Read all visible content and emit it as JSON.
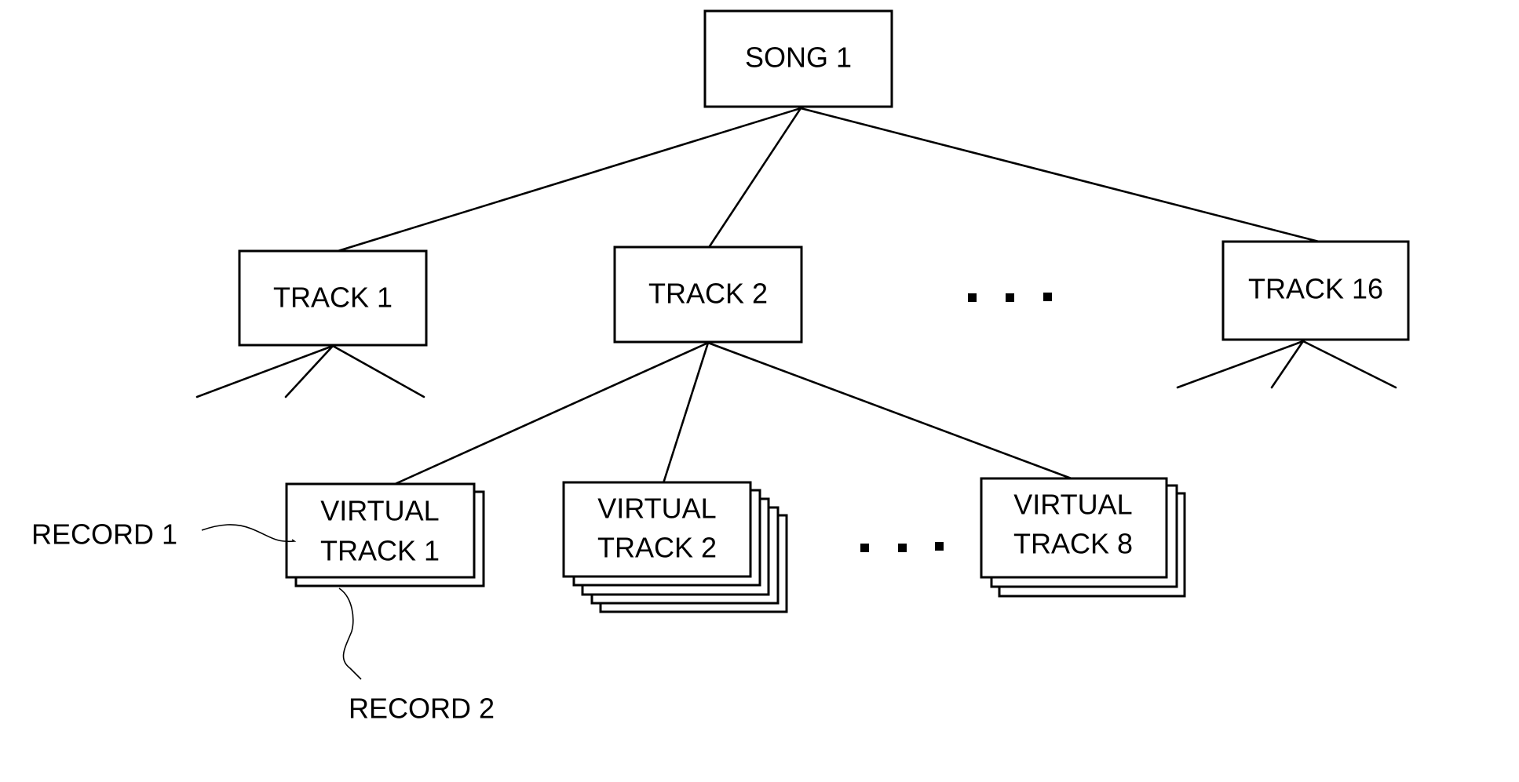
{
  "diagram": {
    "type": "tree",
    "root": {
      "label": "SONG 1"
    },
    "tracks": [
      {
        "label": "TRACK 1"
      },
      {
        "label": "TRACK 2"
      },
      {
        "label": "TRACK 16"
      }
    ],
    "track_ellipsis": "...",
    "virtual_tracks": [
      {
        "line1": "VIRTUAL",
        "line2": "TRACK 1",
        "stack_depth": 2
      },
      {
        "line1": "VIRTUAL",
        "line2": "TRACK 2",
        "stack_depth": 5
      },
      {
        "line1": "VIRTUAL",
        "line2": "TRACK 8",
        "stack_depth": 3
      }
    ],
    "virtual_ellipsis": "...",
    "annotations": [
      {
        "label": "RECORD 1",
        "points_to": "VIRTUAL TRACK 1 (front record)"
      },
      {
        "label": "RECORD 2",
        "points_to": "VIRTUAL TRACK 1 (second record)"
      }
    ]
  }
}
